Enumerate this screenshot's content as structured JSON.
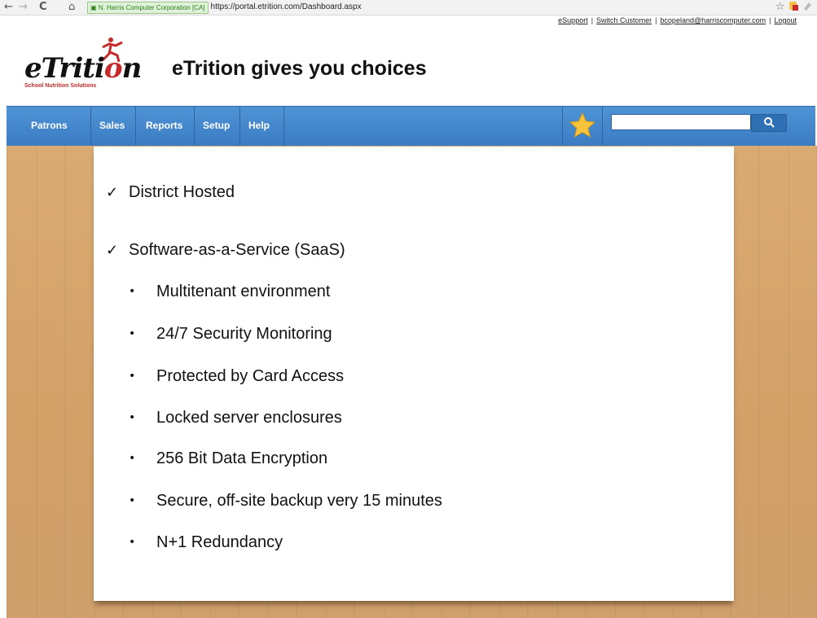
{
  "browser": {
    "back_glyph": "←",
    "forward_glyph": "→",
    "reload_glyph": "C",
    "home_glyph": "⌂",
    "security_label": "N. Harris Computer Corporation [CA]",
    "url": "https://portal.etrition.com/Dashboard.aspx",
    "bookmark_glyph": "☆"
  },
  "header": {
    "links": [
      {
        "label": "eSupport"
      },
      {
        "label": "Switch Customer"
      },
      {
        "label": "bcopeland@harriscomputer.com"
      },
      {
        "label": "Logout"
      }
    ],
    "separator": "|",
    "logo": {
      "word_prefix": "eTriti",
      "word_accent": "o",
      "word_suffix": "n",
      "tagline": "School Nutrition Solutions"
    },
    "title": "eTrition gives you choices"
  },
  "nav": {
    "items": [
      {
        "label": "Patrons"
      },
      {
        "label": "Sales"
      },
      {
        "label": "Reports"
      },
      {
        "label": "Setup"
      },
      {
        "label": "Help"
      }
    ],
    "search": {
      "value": "",
      "placeholder": ""
    }
  },
  "slide": {
    "check_glyph": "✓",
    "bullet_glyph": "•",
    "items": [
      {
        "text": "District Hosted"
      },
      {
        "text": "Software-as-a-Service (SaaS)"
      }
    ],
    "subitems": [
      {
        "text": "Multitenant environment"
      },
      {
        "text": "24/7 Security Monitoring"
      },
      {
        "text": "Protected by Card Access"
      },
      {
        "text": "Locked server enclosures"
      },
      {
        "text": "256 Bit Data Encryption"
      },
      {
        "text": "Secure, off-site backup very 15 minutes"
      },
      {
        "text": "N+1 Redundancy"
      }
    ]
  },
  "colors": {
    "nav_blue": "#3b7cc2",
    "wood": "#d3a068",
    "brand_red": "#c62a2a"
  }
}
